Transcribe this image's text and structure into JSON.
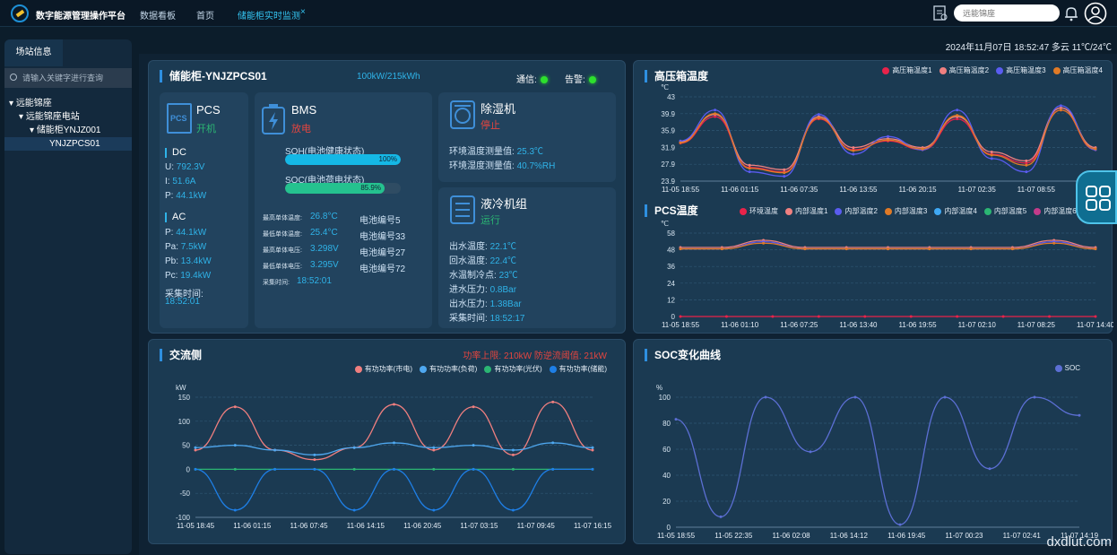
{
  "top": {
    "app_name": "数字能源管理操作平台",
    "nav": [
      "数据看板",
      "首页"
    ],
    "active_tab": "储能柜实时监测",
    "close": "×",
    "search_placeholder": "远能锦座",
    "datetime": "2024年11月07日 18:52:47 多云 11℃/24℃"
  },
  "left": {
    "tab": "场站信息",
    "search_placeholder": "请输入关键字进行查询",
    "tree": [
      "远能锦座",
      "远能锦座电站",
      "储能柜YNJZ001",
      "YNJZPCS01"
    ]
  },
  "overview": {
    "title": "储能柜-YNJZPCS01",
    "capacity": "100kW/215kWh",
    "comm_label": "通信:",
    "alarm_label": "告警:",
    "pcs": {
      "title": "PCS",
      "status": "开机",
      "dc_title": "DC",
      "dc": [
        [
          "U: ",
          "792.3V"
        ],
        [
          "I: ",
          "51.6A"
        ],
        [
          "P: ",
          "44.1kW"
        ]
      ],
      "ac_title": "AC",
      "ac": [
        [
          "P: ",
          "44.1kW"
        ],
        [
          "Pa: ",
          "7.5kW"
        ],
        [
          "Pb: ",
          "13.4kW"
        ],
        [
          "Pc: ",
          "19.4kW"
        ]
      ],
      "time_label": "采集时间:",
      "time": "18:52:01"
    },
    "bms": {
      "title": "BMS",
      "status": "放电",
      "soh_label": "SOH(电池健康状态)",
      "soh": "100%",
      "soh_val": 1.0,
      "soc_label": "SOC(电池荷电状态)",
      "soc": "85.9%",
      "soc_val": 0.859,
      "rows": [
        [
          "最高单体温度:",
          "26.8°C",
          "电池编号5"
        ],
        [
          "最低单体温度:",
          "25.4°C",
          "电池编号33"
        ],
        [
          "最高单体电压:",
          "3.298V",
          "电池编号27"
        ],
        [
          "最低单体电压:",
          "3.295V",
          "电池编号72"
        ]
      ],
      "time_label": "采集时间:",
      "time": "18:52:01"
    },
    "dehum": {
      "title": "除湿机",
      "status": "停止",
      "rows": [
        [
          "环境温度测量值: ",
          "25.3℃"
        ],
        [
          "环境湿度测量值: ",
          "40.7%RH"
        ]
      ]
    },
    "cooler": {
      "title": "液冷机组",
      "status": "运行",
      "rows": [
        [
          "出水温度: ",
          "22.1℃"
        ],
        [
          "回水温度: ",
          "22.4℃"
        ],
        [
          "水温制冷点: ",
          "23℃"
        ],
        [
          "进水压力: ",
          "0.8Bar"
        ],
        [
          "出水压力: ",
          "1.38Bar"
        ],
        [
          "采集时间: ",
          "18:52:17"
        ]
      ]
    }
  },
  "ac_side": {
    "title": "交流侧",
    "limit": "功率上限: 210kW  防逆流阈值: 21kW"
  },
  "hv_temp": {
    "title": "高压箱温度"
  },
  "pcs_temp": {
    "title": "PCS温度"
  },
  "soc_curve": {
    "title": "SOC变化曲线"
  },
  "chart_data": [
    {
      "type": "line",
      "title": "高压箱温度",
      "ylabel": "℃",
      "ylim": [
        23.9,
        43
      ],
      "yticks": [
        "43",
        "39.9",
        "35.9",
        "31.9",
        "27.9",
        "23.9"
      ],
      "categories": [
        "11-05 18:55",
        "11-06 01:15",
        "11-06 07:35",
        "11-06 13:55",
        "11-06 20:15",
        "11-07 02:35",
        "11-07 08:55",
        "11-07 15:15"
      ],
      "series": [
        {
          "name": "高压箱温度1",
          "color": "#e8234a",
          "values": [
            32.5,
            38.5,
            27,
            26,
            38,
            31,
            33,
            31,
            38,
            30,
            28,
            40,
            31
          ]
        },
        {
          "name": "高压箱温度2",
          "color": "#f08080",
          "values": [
            32.8,
            39,
            27.5,
            26.5,
            38.5,
            31.5,
            33.5,
            31.5,
            38.5,
            30.5,
            28.5,
            40.5,
            31.5
          ]
        },
        {
          "name": "高压箱温度3",
          "color": "#5a5cf0",
          "values": [
            33,
            40,
            26,
            25,
            39,
            30,
            34,
            31,
            40,
            29,
            26,
            41,
            31
          ]
        },
        {
          "name": "高压箱温度4",
          "color": "#e07a26",
          "values": [
            32.6,
            39.2,
            26.8,
            25.8,
            38.2,
            30.8,
            33.2,
            31.2,
            38.8,
            29.8,
            27.5,
            40,
            31.2
          ]
        }
      ]
    },
    {
      "type": "line",
      "title": "PCS温度",
      "ylabel": "℃",
      "ylim": [
        0,
        58
      ],
      "yticks": [
        "58",
        "48",
        "36",
        "24",
        "12",
        "0"
      ],
      "categories": [
        "11-05 18:55",
        "11-06 01:10",
        "11-06 07:25",
        "11-06 13:40",
        "11-06 19:55",
        "11-07 02:10",
        "11-07 08:25",
        "11-07 14:40"
      ],
      "series": [
        {
          "name": "环境温度",
          "color": "#e8234a",
          "values": [
            0,
            0,
            0,
            0,
            0,
            0,
            0,
            0,
            0,
            0
          ]
        },
        {
          "name": "内部温度1",
          "color": "#f08080",
          "values": [
            48,
            48,
            53,
            48,
            48,
            48,
            48,
            48,
            48,
            53,
            48
          ]
        },
        {
          "name": "内部温度2",
          "color": "#5a5cf0",
          "values": [
            47,
            47,
            52,
            47,
            47,
            47,
            47,
            47,
            47,
            52,
            47
          ]
        },
        {
          "name": "内部温度3",
          "color": "#e07a26",
          "values": [
            47,
            47,
            51,
            47,
            47,
            47,
            47,
            47,
            47,
            51,
            47
          ]
        },
        {
          "name": "内部温度4",
          "color": "#3fa9f5",
          "values": []
        },
        {
          "name": "内部温度5",
          "color": "#2bb673",
          "values": []
        },
        {
          "name": "内部温度6",
          "color": "#c33b8a",
          "values": []
        }
      ]
    },
    {
      "type": "line",
      "title": "交流侧",
      "ylabel": "kW",
      "ylim": [
        -100,
        150
      ],
      "yticks": [
        "150",
        "100",
        "50",
        "0",
        "-50",
        "-100"
      ],
      "categories": [
        "11-05 18:45",
        "11-06 01:15",
        "11-06 07:45",
        "11-06 14:15",
        "11-06 20:45",
        "11-07 03:15",
        "11-07 09:45",
        "11-07 16:15"
      ],
      "series": [
        {
          "name": "有功功率(市电)",
          "color": "#f07f7f",
          "values": [
            40,
            130,
            40,
            20,
            45,
            135,
            40,
            130,
            30,
            140,
            40
          ]
        },
        {
          "name": "有功功率(负荷)",
          "color": "#4fa8f0",
          "values": [
            45,
            50,
            40,
            30,
            45,
            55,
            45,
            50,
            40,
            55,
            45
          ]
        },
        {
          "name": "有功功率(光伏)",
          "color": "#2bb673",
          "values": [
            0,
            0,
            0,
            0,
            0,
            0,
            0,
            0,
            0,
            0,
            0
          ]
        },
        {
          "name": "有功功率(储能)",
          "color": "#1e7fe6",
          "values": [
            0,
            -85,
            0,
            0,
            -85,
            0,
            -85,
            0,
            -85,
            0,
            0
          ]
        }
      ]
    },
    {
      "type": "line",
      "title": "SOC变化曲线",
      "ylabel": "%",
      "ylim": [
        0,
        100
      ],
      "yticks": [
        "100",
        "80",
        "60",
        "40",
        "20",
        "0"
      ],
      "categories": [
        "11-05 18:55",
        "11-05 22:35",
        "11-06 02:08",
        "11-06 14:12",
        "11-06 19:45",
        "11-07 00:23",
        "11-07 02:41",
        "11-07 14:19"
      ],
      "series": [
        {
          "name": "SOC",
          "color": "#5c6fd4",
          "values": [
            83,
            8,
            100,
            58,
            100,
            2,
            100,
            45,
            100,
            86
          ]
        }
      ]
    }
  ],
  "watermark": "dxdlut.com"
}
